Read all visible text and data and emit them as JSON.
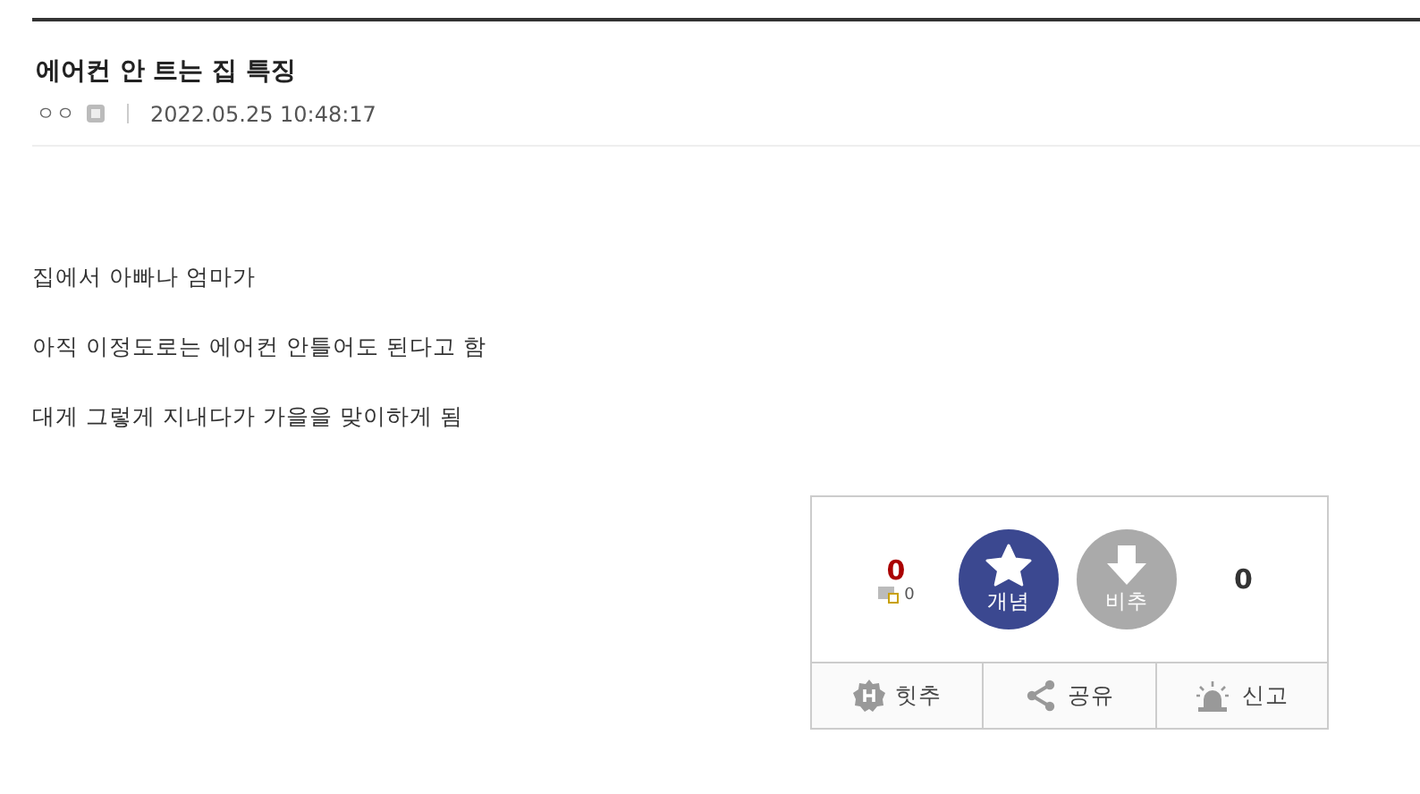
{
  "post": {
    "title": "에어컨 안 트는 집 특징",
    "author": "ㅇㅇ",
    "date": "2022.05.25 10:48:17"
  },
  "body": [
    "집에서 아빠나 엄마가",
    "아직 이정도로는 에어컨 안틀어도 된다고 함",
    "대게 그렇게 지내다가 가을을 맞이하게 됨"
  ],
  "vote": {
    "up_count": "0",
    "up_sub_count": "0",
    "up_label": "개념",
    "down_label": "비추",
    "down_count": "0"
  },
  "actions": [
    {
      "kind": "hit",
      "label": "힛추"
    },
    {
      "kind": "share",
      "label": "공유"
    },
    {
      "kind": "report",
      "label": "신고"
    }
  ]
}
